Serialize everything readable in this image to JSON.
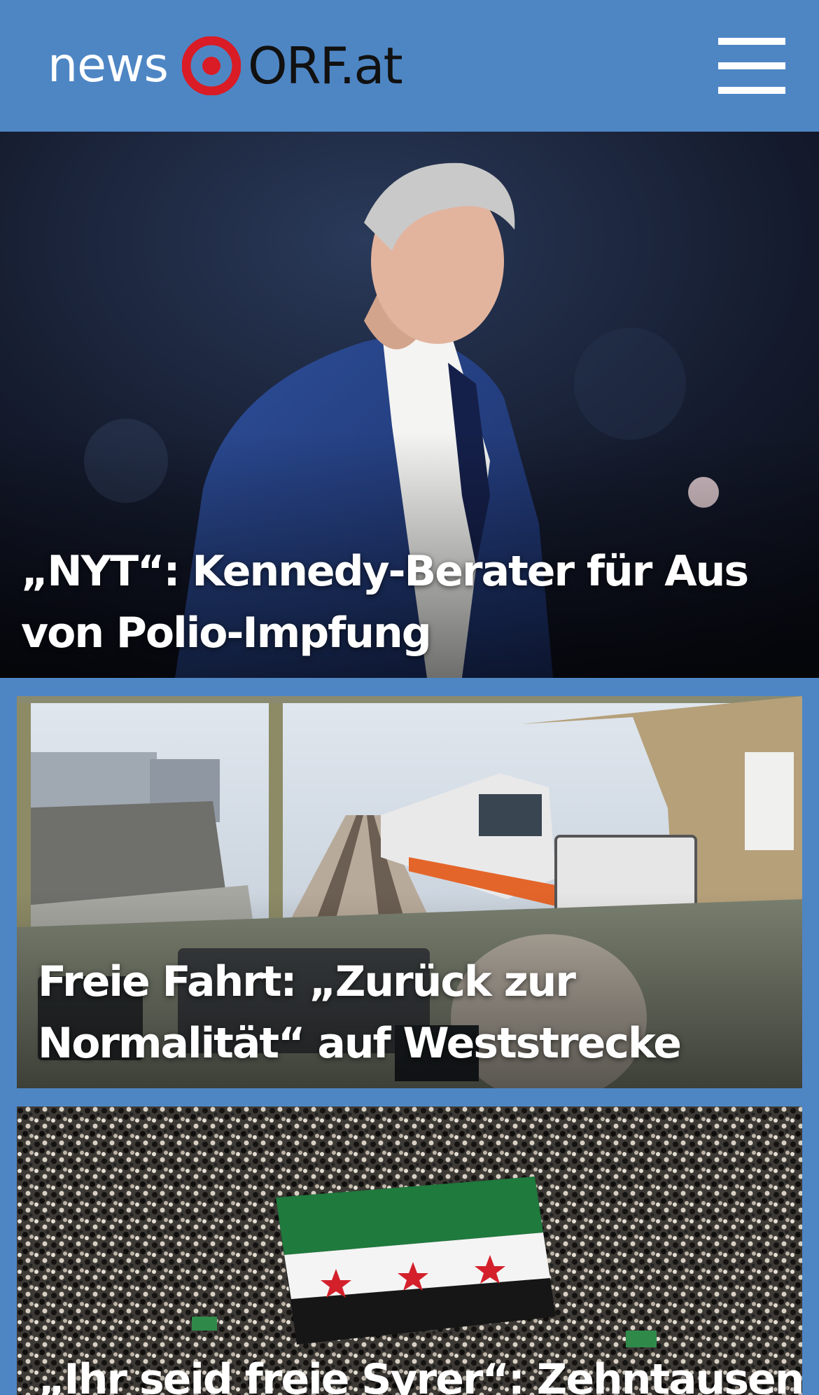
{
  "brand": {
    "background_color": "#4e86c4",
    "logo_mark_color": "#d91c26"
  },
  "header": {
    "logo_news": "news",
    "logo_orf": "ORF.at",
    "menu_icon": "hamburger-menu-icon"
  },
  "stories": [
    {
      "headline": "„NYT“: Kennedy-Berater für Aus von Polio-Impfung"
    },
    {
      "headline": "Freie Fahrt: „Zurück zur Normalität“ auf Weststrecke"
    },
    {
      "headline": "„Ihr seid freie Syrer“: Zehntausende"
    }
  ]
}
